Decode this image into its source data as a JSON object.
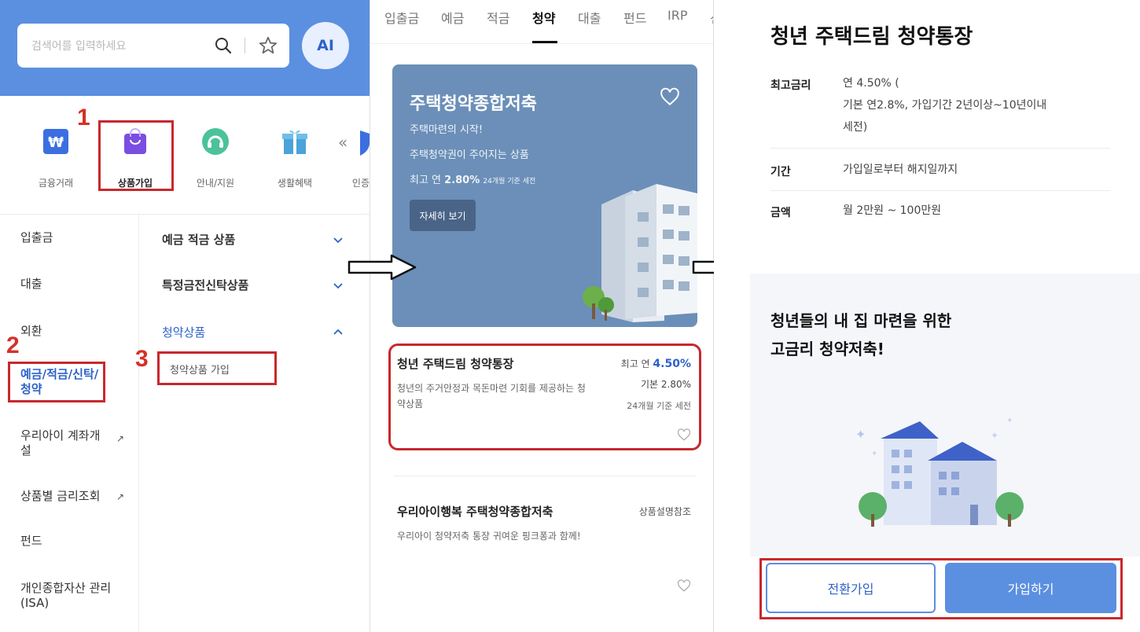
{
  "panel1": {
    "search": {
      "placeholder": "검색어를 입력하세요"
    },
    "avatar_label": "AI",
    "categories": [
      {
        "label": "금융거래",
        "icon": "won-card-icon",
        "color": "#3b6fe0"
      },
      {
        "label": "상품가입",
        "icon": "shopping-bag-icon",
        "color": "#7a4ee0"
      },
      {
        "label": "안내/지원",
        "icon": "support-icon",
        "color": "#4cc29a"
      },
      {
        "label": "생활혜택",
        "icon": "gift-icon",
        "color": "#4aa3d9"
      },
      {
        "label": "인증",
        "icon": "shield-icon",
        "color": "#3b6fe0"
      }
    ],
    "steps": [
      "1",
      "2",
      "3"
    ],
    "left_nav": [
      {
        "label": "입출금"
      },
      {
        "label": "대출"
      },
      {
        "label": "외환"
      },
      {
        "label": "예금/적금/신탁/청약"
      },
      {
        "label": "우리아이 계좌개설"
      },
      {
        "label": "상품별 금리조회"
      },
      {
        "label": "펀드"
      },
      {
        "label": "개인종합자산 관리(ISA)"
      }
    ],
    "right_nav": [
      {
        "label": "예금 적금 상품"
      },
      {
        "label": "특정금전신탁상품"
      },
      {
        "label": "청약상품"
      }
    ],
    "sub_item": "청약상품 가입"
  },
  "panel2": {
    "tabs": [
      {
        "label": "입출금"
      },
      {
        "label": "예금"
      },
      {
        "label": "적금"
      },
      {
        "label": "청약"
      },
      {
        "label": "대출"
      },
      {
        "label": "펀드"
      },
      {
        "label": "IRP"
      },
      {
        "label": "신"
      }
    ],
    "active_tab": "청약",
    "banner": {
      "title": "주택청약종합저축",
      "line1": "주택마련의 시작!",
      "line2": "주택청약권이 주어지는 상품",
      "line3_prefix": "최고 연",
      "line3_rate": "2.80%",
      "line3_suffix": "24개월 기준 세전",
      "button": "자세히 보기"
    },
    "products": [
      {
        "name": "청년 주택드림 청약통장",
        "desc": "청년의 주거안정과 목돈마련 기회를 제공하는 청약상품",
        "rate_label": "최고 연",
        "rate": "4.50%",
        "base": "기본 2.80%",
        "note": "24개월 기준 세전"
      },
      {
        "name": "우리아이행복 주택청약종합저축",
        "desc": "우리아이 청약저축 통장 귀여운 핑크퐁과 함께!",
        "rate_label": "상품설명참조"
      }
    ]
  },
  "panel3": {
    "title": "청년 주택드림 청약통장",
    "rows": [
      {
        "key": "최고금리",
        "value_line1": "연 4.50% (",
        "value_line2": "기본 연2.8%, 가입기간 2년이상~10년이내",
        "value_line3": "세전)"
      },
      {
        "key": "기간",
        "value": "가입일로부터 해지일까지"
      },
      {
        "key": "금액",
        "value": "월 2만원 ~ 100만원"
      }
    ],
    "promo_line1": "청년들의 내 집 마련을 위한",
    "promo_line2": "고금리 청약저축!",
    "buttons": {
      "switch": "전환가입",
      "join": "가입하기"
    }
  },
  "colors": {
    "header_blue": "#5b8fe0",
    "link_blue": "#2e62c9",
    "highlight_red": "#c8282d",
    "banner_blue": "#6b8fb8"
  }
}
